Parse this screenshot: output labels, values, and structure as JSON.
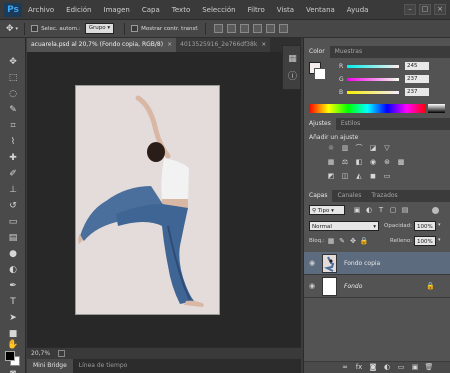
{
  "app": {
    "logo": "Ps"
  },
  "menu": [
    "Archivo",
    "Edición",
    "Imagen",
    "Capa",
    "Texto",
    "Selección",
    "Filtro",
    "Vista",
    "Ventana",
    "Ayuda"
  ],
  "window_controls": {
    "minimize": "–",
    "maximize": "□",
    "close": "×"
  },
  "options_bar": {
    "auto_select_label": "Selec. autom.:",
    "auto_select_value": "Grupo",
    "show_transform_label": "Mostrar contr. transf."
  },
  "document_tabs": [
    {
      "label": "acuarela.psd al 20,7% (Fondo copia, RGB/8)",
      "close": "×"
    },
    {
      "label": "4013525916_2e766df38k",
      "close": "×"
    }
  ],
  "status_bar": {
    "zoom": "20,7%"
  },
  "bottom_tabs": {
    "mini_bridge": "Mini Bridge",
    "timeline": "Línea de tiempo"
  },
  "color_panel": {
    "tabs": [
      "Color",
      "Muestras"
    ],
    "r_label": "R",
    "r_value": "245",
    "g_label": "G",
    "g_value": "237",
    "b_label": "B",
    "b_value": "237",
    "foreground_color": "#f5eded"
  },
  "adjustments_panel": {
    "tabs": [
      "Ajustes",
      "Estilos"
    ],
    "heading": "Añadir un ajuste"
  },
  "layers_panel": {
    "tabs": [
      "Capas",
      "Canales",
      "Trazados"
    ],
    "kind_filter": "Tipo",
    "blend_mode": "Normal",
    "opacity_label": "Opacidad:",
    "opacity_value": "100%",
    "lock_label": "Bloq.:",
    "fill_label": "Relleno:",
    "fill_value": "100%",
    "layers": [
      {
        "name": "Fondo copia",
        "selected": true
      },
      {
        "name": "Fondo",
        "selected": false,
        "locked": true
      }
    ]
  },
  "colors": {
    "ui_dark": "#3c3c3c",
    "canvas_bg": "#282828",
    "doc_bg": "#e4dbdb",
    "selected_layer": "#5d6b7e",
    "jeans": "#4a6f9c",
    "top": "#f2f2f2"
  }
}
